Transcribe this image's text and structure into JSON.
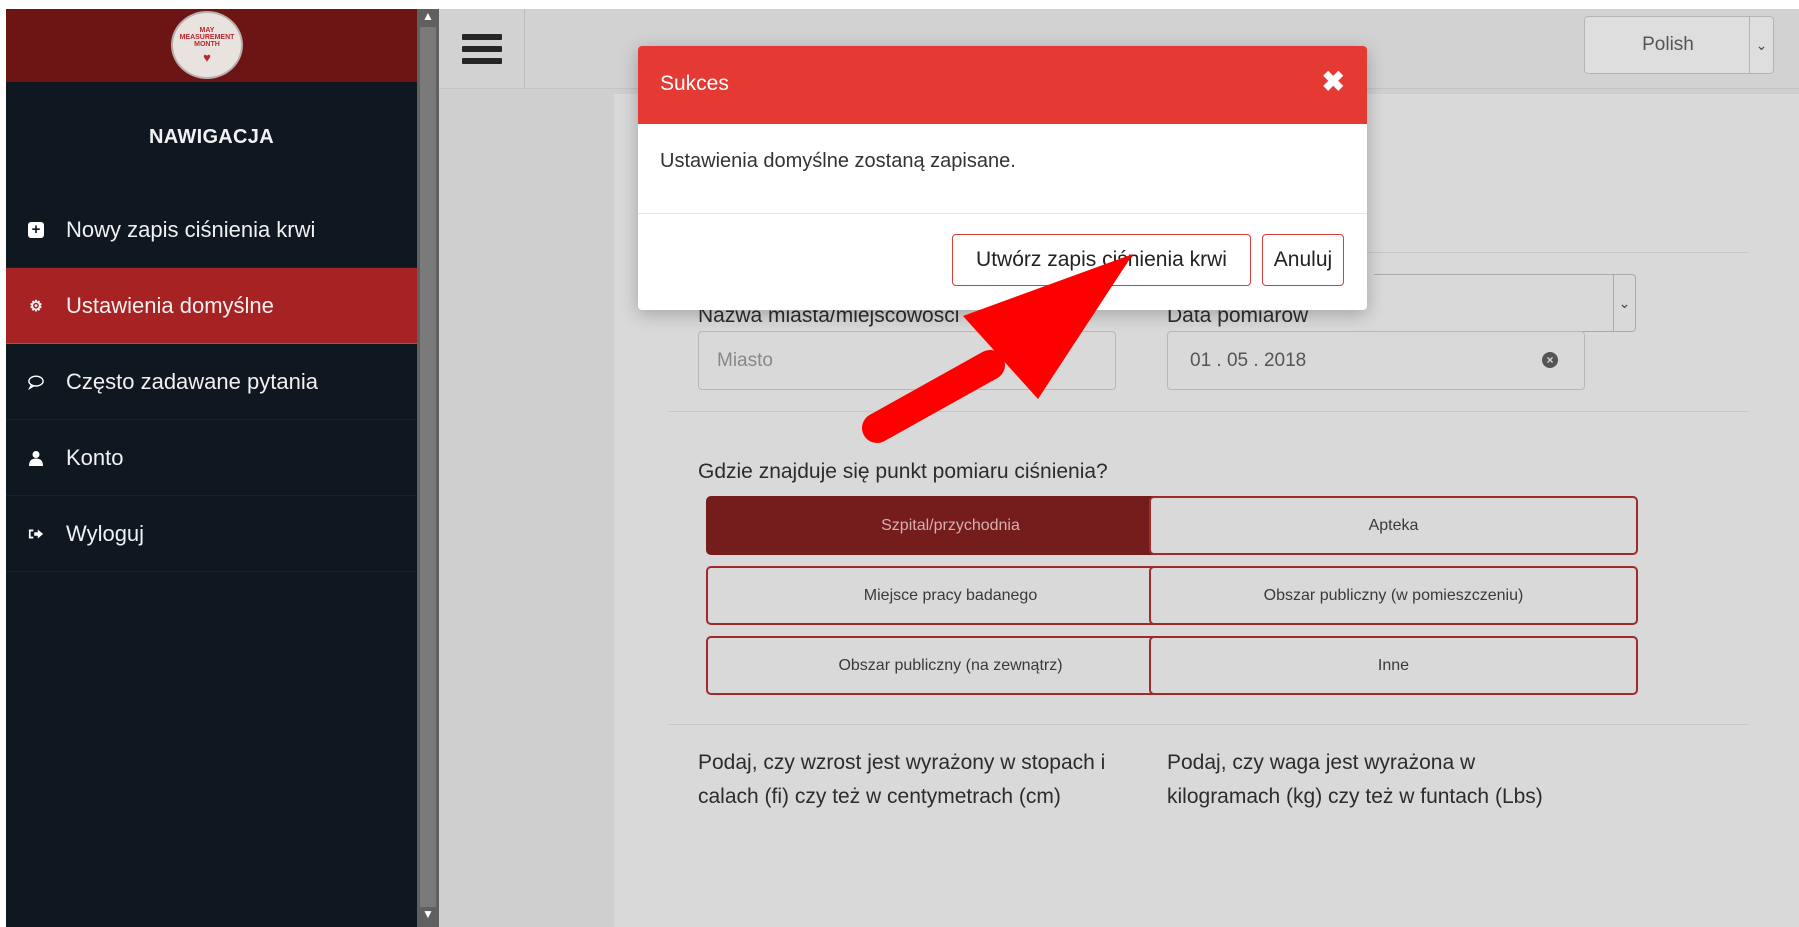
{
  "sidebar": {
    "logo": {
      "line1": "MAY",
      "line2": "MEASUREMENT",
      "line3": "MONTH",
      "heart": "♥"
    },
    "title": "NAWIGACJA",
    "items": [
      {
        "label": "Nowy zapis ciśnienia krwi",
        "icon": "plus-square-icon"
      },
      {
        "label": "Ustawienia domyślne",
        "icon": "gear-icon",
        "active": true
      },
      {
        "label": "Często zadawane pytania",
        "icon": "comment-icon"
      },
      {
        "label": "Konto",
        "icon": "user-icon"
      },
      {
        "label": "Wyloguj",
        "icon": "sign-out-icon"
      }
    ]
  },
  "topbar": {
    "language": "Polish"
  },
  "form": {
    "city_label": "Nazwa miasta/miejscowości",
    "city_placeholder": "Miasto",
    "date_label": "Data pomiarów",
    "date_value": "01 . 05 . 2018",
    "location_question": "Gdzie znajduje się punkt pomiaru ciśnienia?",
    "location_options": [
      {
        "label": "Szpital/przychodnia",
        "selected": true
      },
      {
        "label": "Apteka",
        "selected": false
      },
      {
        "label": "Miejsce pracy badanego",
        "selected": false
      },
      {
        "label": "Obszar publiczny (w pomieszczeniu)",
        "selected": false
      },
      {
        "label": "Obszar publiczny (na zewnątrz)",
        "selected": false
      },
      {
        "label": "Inne",
        "selected": false
      }
    ],
    "height_question_line1": "Podaj, czy wzrost jest wyrażony w stopach i",
    "height_question_line2": "calach (fi) czy też w centymetrach (cm)",
    "weight_question_line1": "Podaj, czy waga jest wyrażona w",
    "weight_question_line2": "kilogramach (kg) czy też w funtach (Lbs)"
  },
  "modal": {
    "title": "Sukces",
    "close_symbol": "✖",
    "message": "Ustawienia domyślne zostaną zapisane.",
    "create_button": "Utwórz zapis ciśnienia krwi",
    "cancel_button": "Anuluj"
  },
  "colors": {
    "sidebar_bg": "#0f1720",
    "active_item": "#a72222",
    "modal_header": "#e53a33",
    "selected_option": "#751c1c",
    "annotation_arrow": "#ff0000"
  }
}
